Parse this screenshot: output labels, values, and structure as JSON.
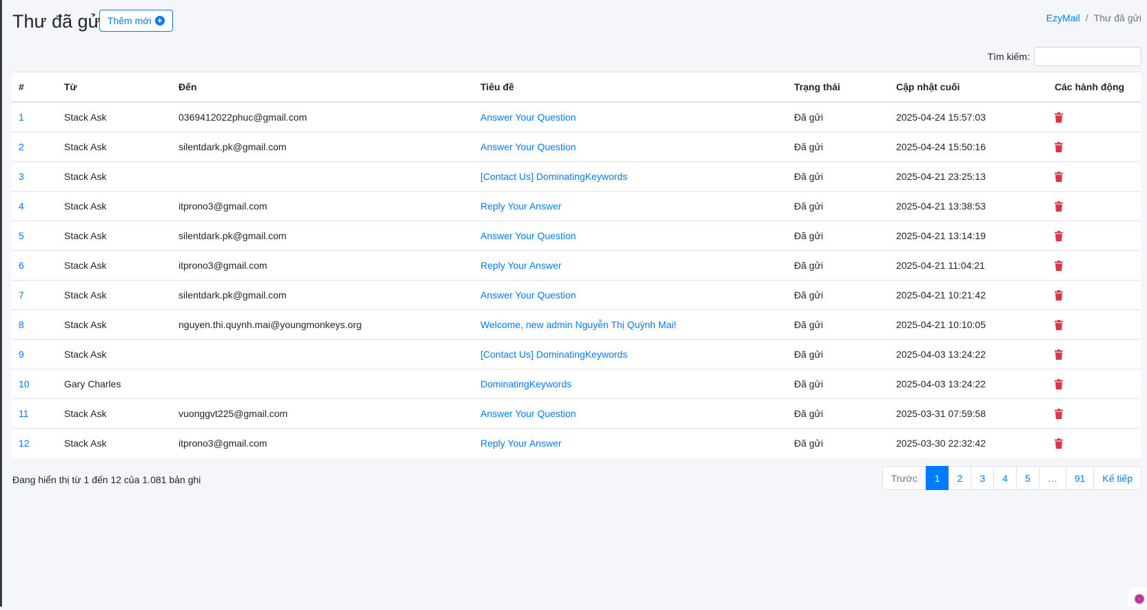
{
  "header": {
    "title": "Thư đã gửi",
    "add_button_label": "Thêm mới",
    "add_icon": "plus-circle-icon"
  },
  "breadcrumb": {
    "home": "EzyMail",
    "separator": "/",
    "current": "Thư đã gửi"
  },
  "search": {
    "label": "Tìm kiếm:",
    "value": "",
    "placeholder": ""
  },
  "table": {
    "columns": [
      "#",
      "Từ",
      "Đến",
      "Tiêu đề",
      "Trạng thái",
      "Cập nhật cuối",
      "Các hành động"
    ],
    "rows": [
      {
        "id": "1",
        "from": "Stack Ask",
        "to": "0369412022phuc@gmail.com",
        "subject": "Answer Your Question",
        "status": "Đã gửi",
        "updated": "2025-04-24 15:57:03"
      },
      {
        "id": "2",
        "from": "Stack Ask",
        "to": "silentdark.pk@gmail.com",
        "subject": "Answer Your Question",
        "status": "Đã gửi",
        "updated": "2025-04-24 15:50:16"
      },
      {
        "id": "3",
        "from": "Stack Ask",
        "to": "",
        "subject": "[Contact Us] DominatingKeywords",
        "status": "Đã gửi",
        "updated": "2025-04-21 23:25:13"
      },
      {
        "id": "4",
        "from": "Stack Ask",
        "to": "itprono3@gmail.com",
        "subject": "Reply Your Answer",
        "status": "Đã gửi",
        "updated": "2025-04-21 13:38:53"
      },
      {
        "id": "5",
        "from": "Stack Ask",
        "to": "silentdark.pk@gmail.com",
        "subject": "Answer Your Question",
        "status": "Đã gửi",
        "updated": "2025-04-21 13:14:19"
      },
      {
        "id": "6",
        "from": "Stack Ask",
        "to": "itprono3@gmail.com",
        "subject": "Reply Your Answer",
        "status": "Đã gửi",
        "updated": "2025-04-21 11:04:21"
      },
      {
        "id": "7",
        "from": "Stack Ask",
        "to": "silentdark.pk@gmail.com",
        "subject": "Answer Your Question",
        "status": "Đã gửi",
        "updated": "2025-04-21 10:21:42"
      },
      {
        "id": "8",
        "from": "Stack Ask",
        "to": "nguyen.thi.quynh.mai@youngmonkeys.org",
        "subject": "Welcome, new admin Nguyễn Thị Quỳnh Mai!",
        "status": "Đã gửi",
        "updated": "2025-04-21 10:10:05"
      },
      {
        "id": "9",
        "from": "Stack Ask",
        "to": "",
        "subject": "[Contact Us] DominatingKeywords",
        "status": "Đã gửi",
        "updated": "2025-04-03 13:24:22"
      },
      {
        "id": "10",
        "from": "Gary Charles",
        "to": "",
        "subject": "DominatingKeywords",
        "status": "Đã gửi",
        "updated": "2025-04-03 13:24:22"
      },
      {
        "id": "11",
        "from": "Stack Ask",
        "to": "vuonggvt225@gmail.com",
        "subject": "Answer Your Question",
        "status": "Đã gửi",
        "updated": "2025-03-31 07:59:58"
      },
      {
        "id": "12",
        "from": "Stack Ask",
        "to": "itprono3@gmail.com",
        "subject": "Reply Your Answer",
        "status": "Đã gửi",
        "updated": "2025-03-30 22:32:42"
      }
    ],
    "action_icon": "trash-icon",
    "action_color": "#dc3545"
  },
  "footer": {
    "info": "Đang hiển thị từ 1 đến 12 của 1.081 bản ghi"
  },
  "pagination": {
    "prev": "Trước",
    "pages": [
      "1",
      "2",
      "3",
      "4",
      "5",
      "…",
      "91"
    ],
    "active": "1",
    "next": "Kế tiếp"
  },
  "colors": {
    "accent": "#007bff",
    "danger": "#dc3545",
    "background": "#f4f6f9"
  }
}
